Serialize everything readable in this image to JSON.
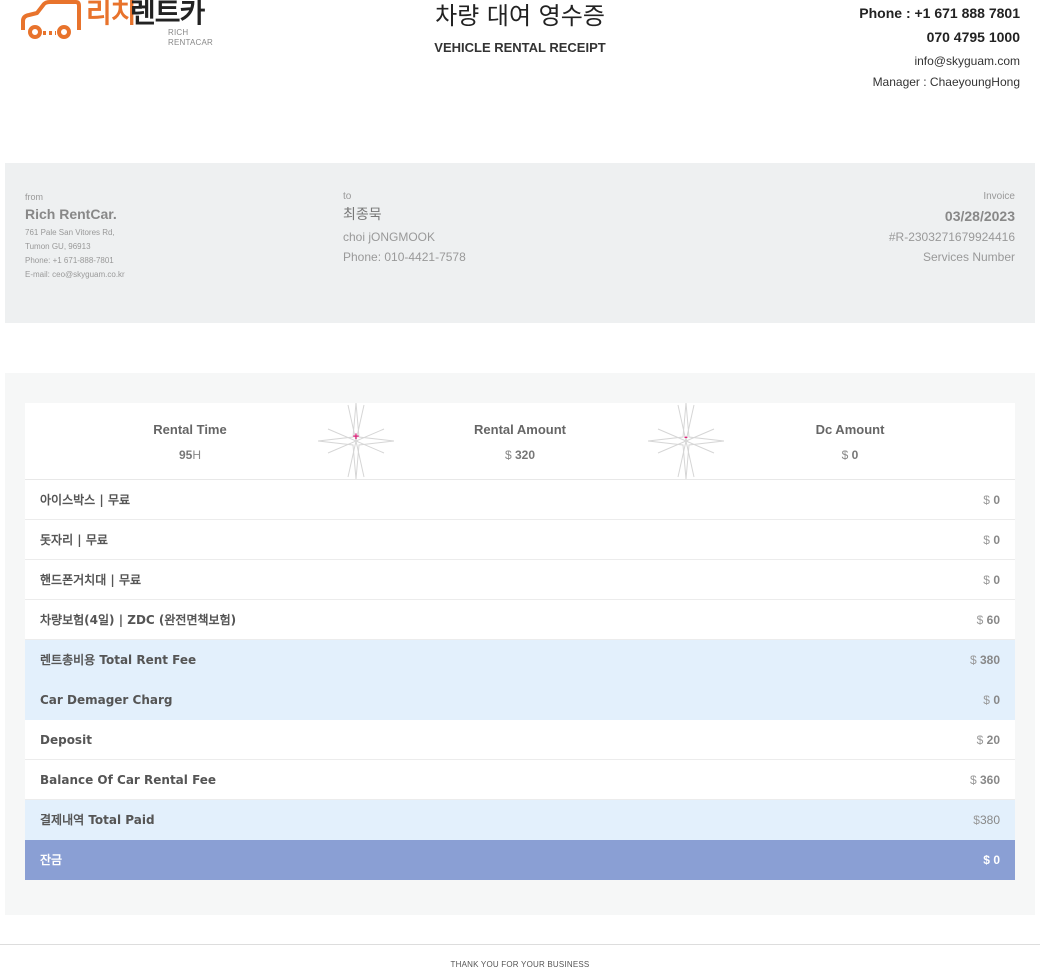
{
  "brand": {
    "logo_ko_part1": "리치",
    "logo_ko_part2": "렌트카",
    "logo_en": "RICH RENTACAR",
    "accent_color": "#e8732c"
  },
  "title": {
    "ko": "차량 대여 영수증",
    "en": "VEHICLE RENTAL RECEIPT"
  },
  "contact": {
    "phone_line1": "Phone : +1 671 888 7801",
    "phone_line2": "070 4795 1000",
    "email": "info@skyguam.com",
    "manager": "Manager : ChaeyoungHong"
  },
  "from": {
    "label": "from",
    "name": "Rich RentCar.",
    "address1": "761 Pale San Vitores Rd,",
    "address2": "Tumon GU, 96913",
    "phone": "Phone: +1 671-888-7801",
    "email": "E-mail: ceo@skyguam.co.kr"
  },
  "to": {
    "label": "to",
    "name_ko": "최종묵",
    "name_en": "choi jONGMOOK",
    "phone": "Phone: 010-4421-7578"
  },
  "invoice": {
    "label": "Invoice",
    "date": "03/28/2023",
    "number": "#R-2303271679924416",
    "services_label": "Services Number"
  },
  "summary": {
    "rental_time": {
      "label": "Rental Time",
      "value": "95",
      "unit": "H"
    },
    "plus_symbol": "+",
    "rental_amount": {
      "label": "Rental Amount",
      "currency": "$",
      "value": "320"
    },
    "minus_symbol": "-",
    "dc_amount": {
      "label": "Dc Amount",
      "currency": "$",
      "value": "0"
    }
  },
  "items": [
    {
      "label": "아이스박스 | 무료",
      "currency": "$",
      "amount": "0"
    },
    {
      "label": "돗자리 | 무료",
      "currency": "$",
      "amount": "0"
    },
    {
      "label": "핸드폰거치대 | 무료",
      "currency": "$",
      "amount": "0"
    },
    {
      "label": "차량보험(4일) | ZDC (완전면책보험)",
      "currency": "$",
      "amount": "60"
    },
    {
      "label": "렌트총비용 Total Rent Fee",
      "currency": "$",
      "amount": "380"
    },
    {
      "label": "Car Demager Charg",
      "currency": "$",
      "amount": "0"
    },
    {
      "label": "Deposit",
      "currency": "$",
      "amount": "20"
    },
    {
      "label": "Balance Of Car Rental Fee",
      "currency": "$",
      "amount": "360"
    },
    {
      "label": "결제내역 Total Paid",
      "currency": "$",
      "amount": "380"
    },
    {
      "label": "잔금",
      "currency": "$",
      "amount": "0"
    }
  ],
  "colors": {
    "highlight_row": "#e3f0fc",
    "balance_row": "#8a9fd4",
    "operator_symbol": "#e0207a"
  },
  "footer": {
    "text": "THANK YOU FOR YOUR BUSINESS"
  }
}
